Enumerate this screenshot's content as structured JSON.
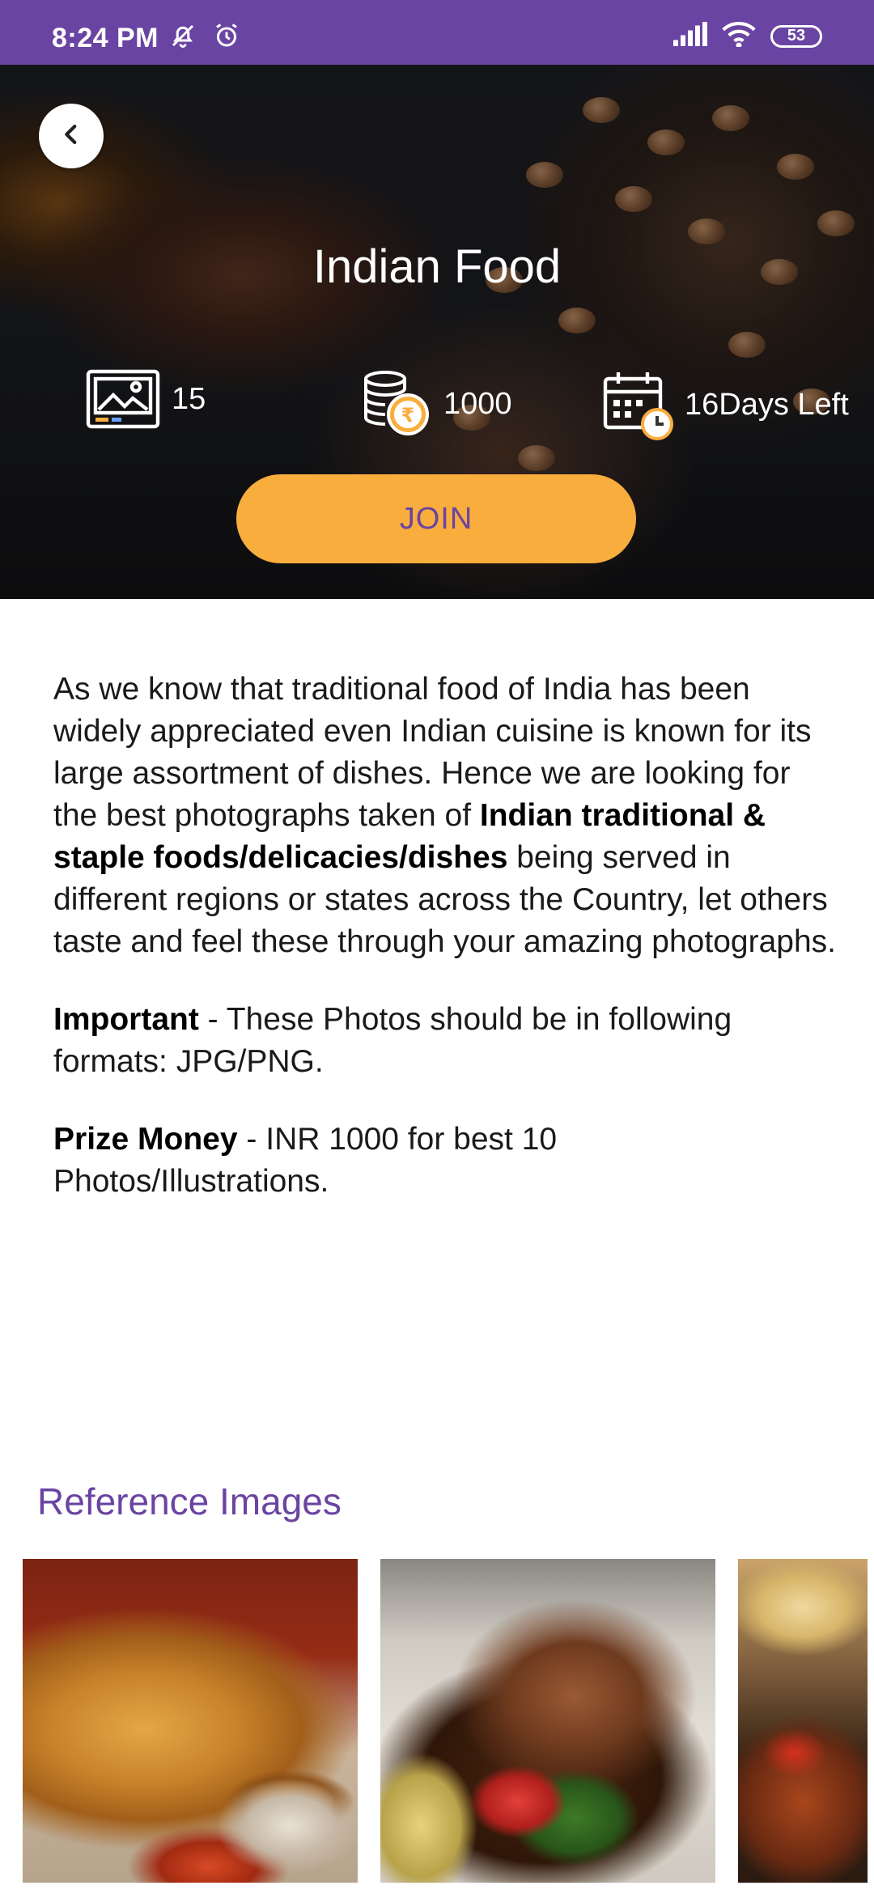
{
  "status_bar": {
    "time": "8:24 PM",
    "battery": "53"
  },
  "hero": {
    "title": "Indian Food",
    "stats": {
      "photos": "15",
      "prize": "1000",
      "days_left": "16Days Left"
    },
    "join_label": "JOIN"
  },
  "description": {
    "p1_before": "As we know that traditional food of India has been widely appreciated even Indian cuisine is known for its large assortment of dishes. Hence we are looking for the best photographs taken of ",
    "p1_bold": "Indian traditional & staple foods/delicacies/dishes",
    "p1_after": " being served in different regions or states across the Country, let others taste and feel these through your amazing photographs.",
    "p2_bold": "Important",
    "p2_text": " - These Photos should be in following formats: JPG/PNG.",
    "p3_bold": "Prize Money",
    "p3_text": " - INR 1000 for best 10 Photos/Illustrations."
  },
  "reference": {
    "title": "Reference Images"
  },
  "colors": {
    "brand_purple": "#6a44a2",
    "join_orange": "#f9ad3d"
  }
}
